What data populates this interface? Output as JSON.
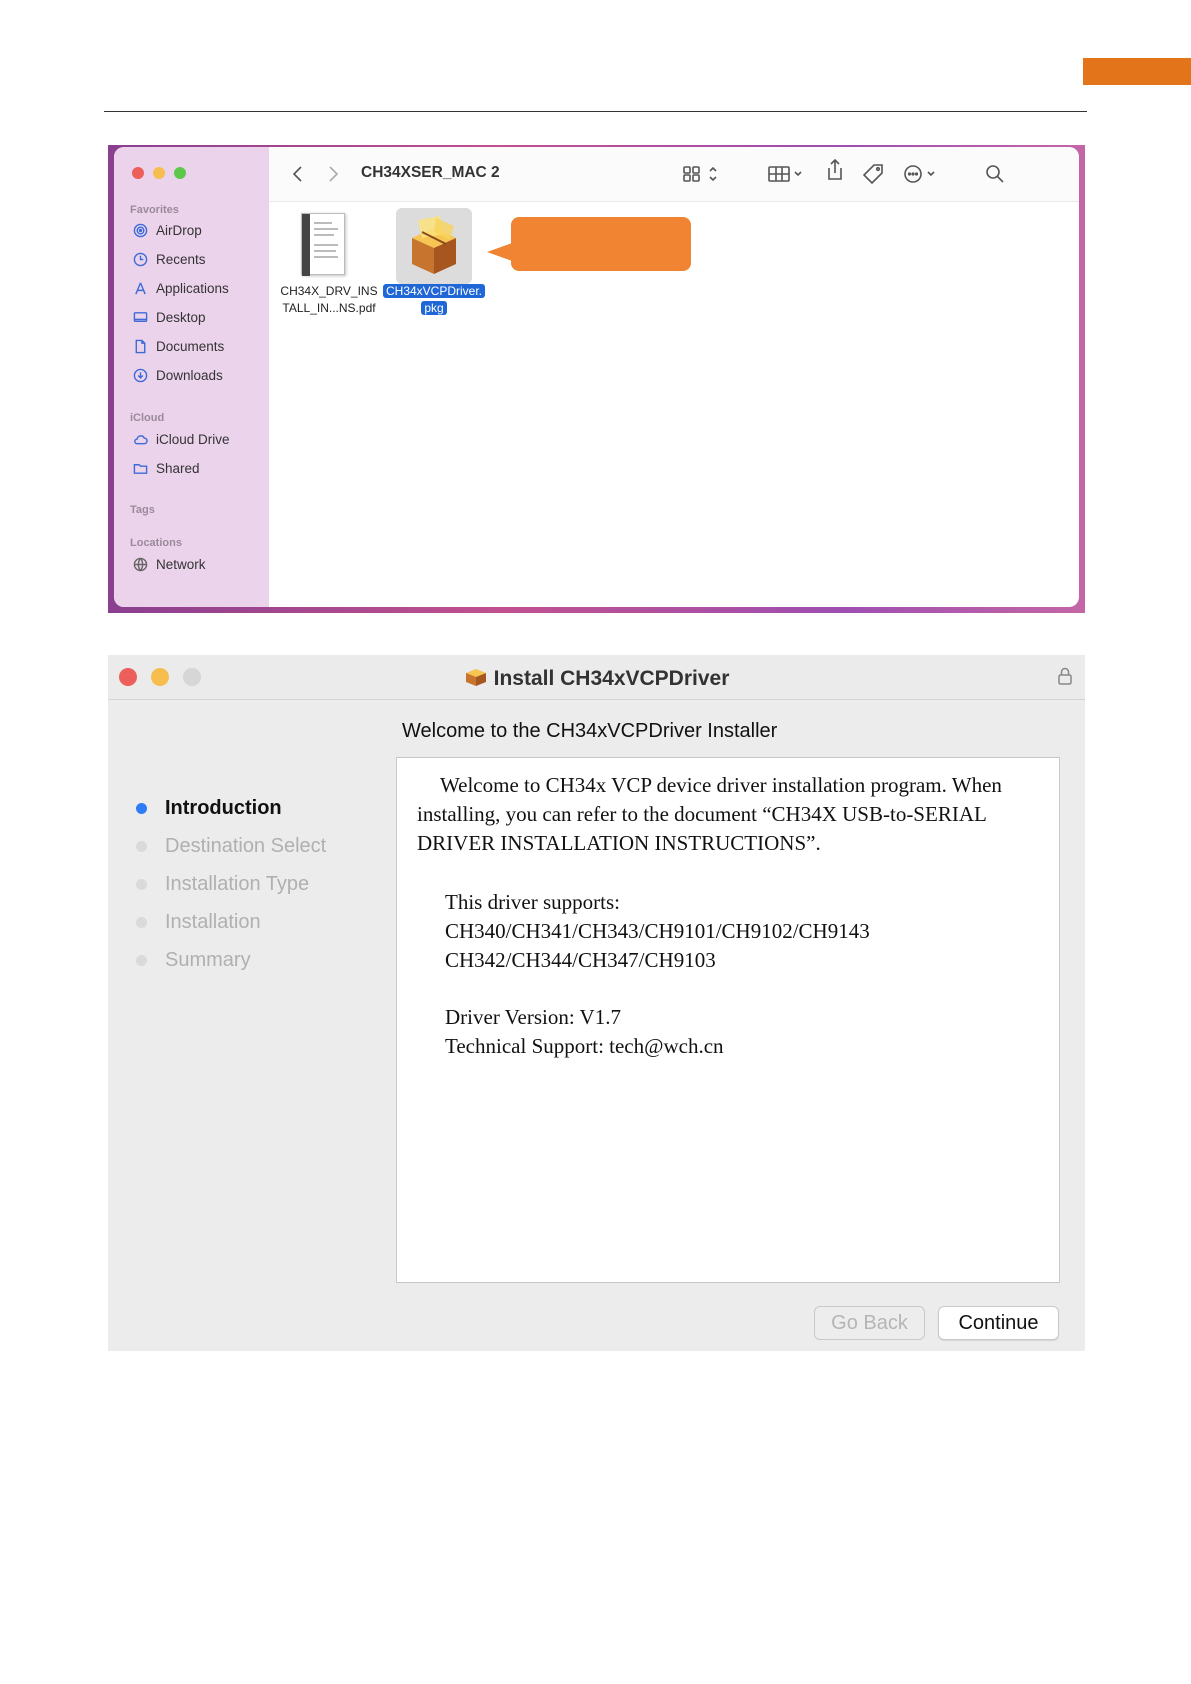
{
  "finder": {
    "title": "CH34XSER_MAC 2",
    "sidebar": {
      "favorites_label": "Favorites",
      "favorites": [
        {
          "label": "AirDrop",
          "icon": "airdrop-icon"
        },
        {
          "label": "Recents",
          "icon": "clock-icon"
        },
        {
          "label": "Applications",
          "icon": "applications-icon"
        },
        {
          "label": "Desktop",
          "icon": "desktop-icon"
        },
        {
          "label": "Documents",
          "icon": "document-icon"
        },
        {
          "label": "Downloads",
          "icon": "download-icon"
        }
      ],
      "icloud_label": "iCloud",
      "icloud": [
        {
          "label": "iCloud Drive",
          "icon": "cloud-icon"
        },
        {
          "label": "Shared",
          "icon": "shared-folder-icon"
        }
      ],
      "tags_label": "Tags",
      "locations_label": "Locations",
      "locations": [
        {
          "label": "Network",
          "icon": "globe-icon"
        }
      ]
    },
    "files": [
      {
        "line1": "CH34X_DRV_INS",
        "line2": "TALL_IN...NS.pdf",
        "icon": "pdf-document-icon",
        "selected": false
      },
      {
        "line1": "CH34xVCPDriver.",
        "line2": "pkg",
        "icon": "package-icon",
        "selected": true
      }
    ],
    "accent_color": "#1f66d6",
    "callout_color": "#f08432"
  },
  "installer": {
    "window_title": "Install CH34xVCPDriver",
    "heading": "Welcome to the CH34xVCPDriver Installer",
    "steps": [
      {
        "label": "Introduction",
        "active": true
      },
      {
        "label": "Destination Select",
        "active": false
      },
      {
        "label": "Installation Type",
        "active": false
      },
      {
        "label": "Installation",
        "active": false
      },
      {
        "label": "Summary",
        "active": false
      }
    ],
    "body": {
      "intro": "Welcome to CH34x VCP device driver installation program. When installing, you can refer to the document “CH34X USB-to-SERIAL DRIVER INSTALLATION INSTRUCTIONS”.",
      "supports_title": "This driver supports:",
      "supports_line1": "CH340/CH341/CH343/CH9101/CH9102/CH9143",
      "supports_line2": "CH342/CH344/CH347/CH9103",
      "version": "Driver Version: V1.7",
      "support": "Technical Support: tech@wch.cn"
    },
    "buttons": {
      "back": "Go Back",
      "continue": "Continue"
    },
    "active_step_color": "#2f7df6"
  },
  "page": {
    "corner_tab_color": "#e3741a"
  }
}
